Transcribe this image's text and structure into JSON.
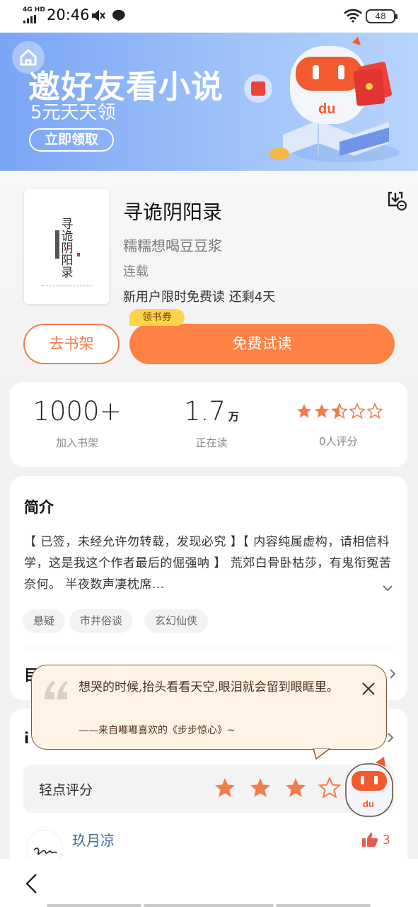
{
  "status_bar": {
    "network": "4G HD",
    "time": "20:46",
    "battery": "48"
  },
  "banner": {
    "title": "邀好友看小说",
    "subtitle": "5元天天领",
    "button": "立即领取",
    "mascot_logo": "du"
  },
  "book": {
    "cover_title": "寻诡阴阳录",
    "title": "寻诡阴阳录",
    "author": "糯糯想喝豆豆浆",
    "status": "连载",
    "free_note": "新用户限时免费读 还剩4天",
    "download_icon": "download-icon"
  },
  "actions": {
    "shelf_button": "去书架",
    "read_button": "免费试读",
    "coupon_badge": "领书券"
  },
  "stats": {
    "shelf_count": "1000+",
    "shelf_label": "加入书架",
    "reading_count": "1.7",
    "reading_unit": "万",
    "reading_label": "正在读",
    "rating_stars": 2.5,
    "rating_label": "0人评分"
  },
  "intro": {
    "heading": "简介",
    "text": "【 已签，未经允许勿转载，发现必究 】【 内容纯属虚构，请相信科学，这是我这个作者最后的倔强呐 】 荒郊白骨卧枯莎，有鬼衔冤苦奈何。 半夜数声凄枕席...",
    "tags": [
      "悬疑",
      "市井俗谈",
      "玄幻仙侠"
    ],
    "catalog_stub": "目"
  },
  "comments": {
    "heading_stub": "i",
    "rate_label": "轻点评分",
    "rate_stars": 4,
    "user_name": "玖月凉",
    "likes": "3"
  },
  "quote_popup": {
    "text": "想哭的时候,抬头看看天空,眼泪就会留到眼眶里。",
    "source": "——来自嘟嘟喜欢的《步步惊心》~",
    "mascot_logo": "du"
  },
  "colors": {
    "accent": "#ff8244",
    "star": "#f07d4a",
    "banner_start": "#7aa5f6",
    "coupon": "#ffd34b"
  }
}
